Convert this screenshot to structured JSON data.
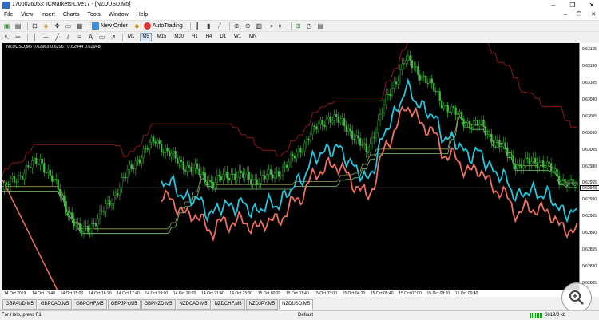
{
  "window": {
    "title": "1700026053: ICMarkets-Live17 - [NZDUSD,M5]",
    "controls": [
      "–",
      "❐",
      "✕"
    ]
  },
  "menu": {
    "items": [
      "File",
      "View",
      "Insert",
      "Charts",
      "Tools",
      "Window",
      "Help"
    ],
    "mdi_controls": [
      "–",
      "❐",
      "✕"
    ]
  },
  "toolbar": {
    "new_order": "New Order",
    "autotrading": "AutoTrading",
    "timeframes": [
      "M1",
      "M5",
      "M15",
      "M30",
      "H1",
      "H4",
      "D1",
      "W1",
      "MN"
    ],
    "active_timeframe": "M5"
  },
  "chart": {
    "symbol_label": "NZDUSD,M5  0.62963 0.62967 0.62944 0.62948",
    "current_price": "0.62948",
    "y_ticks": [
      "0.63155",
      "0.63130",
      "0.63105",
      "0.63080",
      "0.63055",
      "0.63030",
      "0.63005",
      "0.62980",
      "0.62955",
      "0.62930",
      "0.62905",
      "0.62880",
      "0.62855",
      "0.62830",
      "0.62805"
    ],
    "x_ticks": [
      "14 Oct 2019",
      "14 Oct 13:40",
      "14 Oct 15:00",
      "14 Oct 16:20",
      "14 Oct 17:40",
      "14 Oct 19:00",
      "14 Oct 20:20",
      "14 Oct 21:40",
      "14 Oct 23:00",
      "15 Oct 00:20",
      "15 Oct 01:40",
      "15 Oct 03:00",
      "15 Oct 04:20",
      "15 Oct 05:40",
      "15 Oct 07:00",
      "15 Oct 08:20",
      "15 Oct 09:40"
    ],
    "colors": {
      "background": "#000000",
      "candles": "#3fbf3f",
      "line_cyan": "#22c8e0",
      "line_salmon": "#f07060",
      "line_dark_red": "#8a1818",
      "line_olive": "#9aa04a",
      "line_light_green": "#7ec87e"
    }
  },
  "chart_data": {
    "type": "line",
    "series": [
      {
        "values": [
          0.62945,
          0.6297,
          0.6299,
          0.6294,
          0.6288,
          0.629,
          0.62945,
          0.6299,
          0.6302,
          0.6299,
          0.62975,
          0.62955,
          0.6297,
          0.6296,
          0.62965,
          0.62985,
          0.63025,
          0.63055,
          0.6304,
          0.63,
          0.63075,
          0.6314,
          0.63115,
          0.63075,
          0.6305,
          0.6304,
          0.6301,
          0.6298,
          0.6299,
          0.62965,
          0.62948
        ]
      },
      {
        "values": [
          null,
          null,
          null,
          null,
          null,
          null,
          null,
          null,
          null,
          null,
          null,
          null,
          null,
          null,
          null,
          null,
          null,
          null,
          null,
          null,
          null,
          null,
          null,
          null,
          null,
          null,
          null,
          null,
          null,
          null,
          null
        ]
      }
    ]
  },
  "tabs": {
    "items": [
      "GBPAUD,M5",
      "GBPCAD,M5",
      "GBPCHF,M5",
      "GBPJPY,M5",
      "GBPNZD,M5",
      "NZDCAD,M5",
      "NZDCHF,M5",
      "NZDJPY,M5",
      "NZDUSD,M5"
    ],
    "active_index": 8
  },
  "status": {
    "help": "For Help, press F1",
    "profile": "Default",
    "traffic": "6819/3 kb"
  }
}
